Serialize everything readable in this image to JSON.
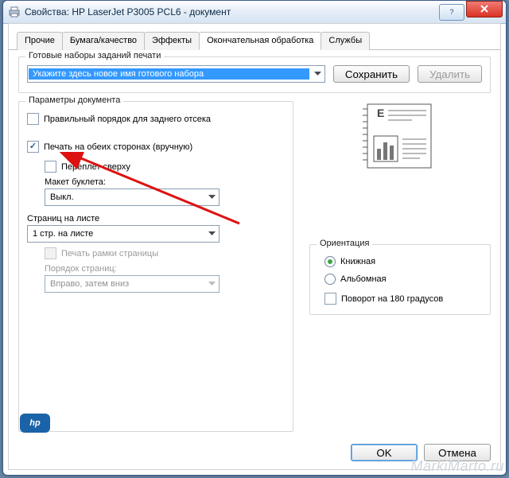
{
  "window": {
    "title": "Свойства: HP LaserJet P3005 PCL6 - документ"
  },
  "tabs": {
    "items": [
      "Прочие",
      "Бумага/качество",
      "Эффекты",
      "Окончательная обработка",
      "Службы"
    ],
    "active_index": 3
  },
  "presets": {
    "group_title": "Готовые наборы заданий печати",
    "selected": "Укажите здесь новое имя готового набора",
    "save_label": "Сохранить",
    "delete_label": "Удалить"
  },
  "doc": {
    "group_title": "Параметры документа",
    "correct_order_label": "Правильный порядок для заднего отсека",
    "correct_order_checked": false,
    "duplex_label": "Печать на обеих сторонах (вручную)",
    "duplex_checked": true,
    "bind_top_label": "Переплет сверху",
    "bind_top_checked": false,
    "booklet_label": "Макет буклета:",
    "booklet_value": "Выкл.",
    "pages_label": "Страниц на листе",
    "pages_value": "1 стр. на листе",
    "frame_label": "Печать рамки страницы",
    "order_label": "Порядок страниц:",
    "order_value": "Вправо, затем вниз"
  },
  "orientation": {
    "group_title": "Ориентация",
    "portrait": "Книжная",
    "landscape": "Альбомная",
    "rotate": "Поворот на 180 градусов",
    "selected": "portrait",
    "rotate_checked": false
  },
  "footer": {
    "ok": "OK",
    "cancel": "Отмена"
  },
  "logo_text": "hp",
  "watermark": "MarkiMarto.ru"
}
